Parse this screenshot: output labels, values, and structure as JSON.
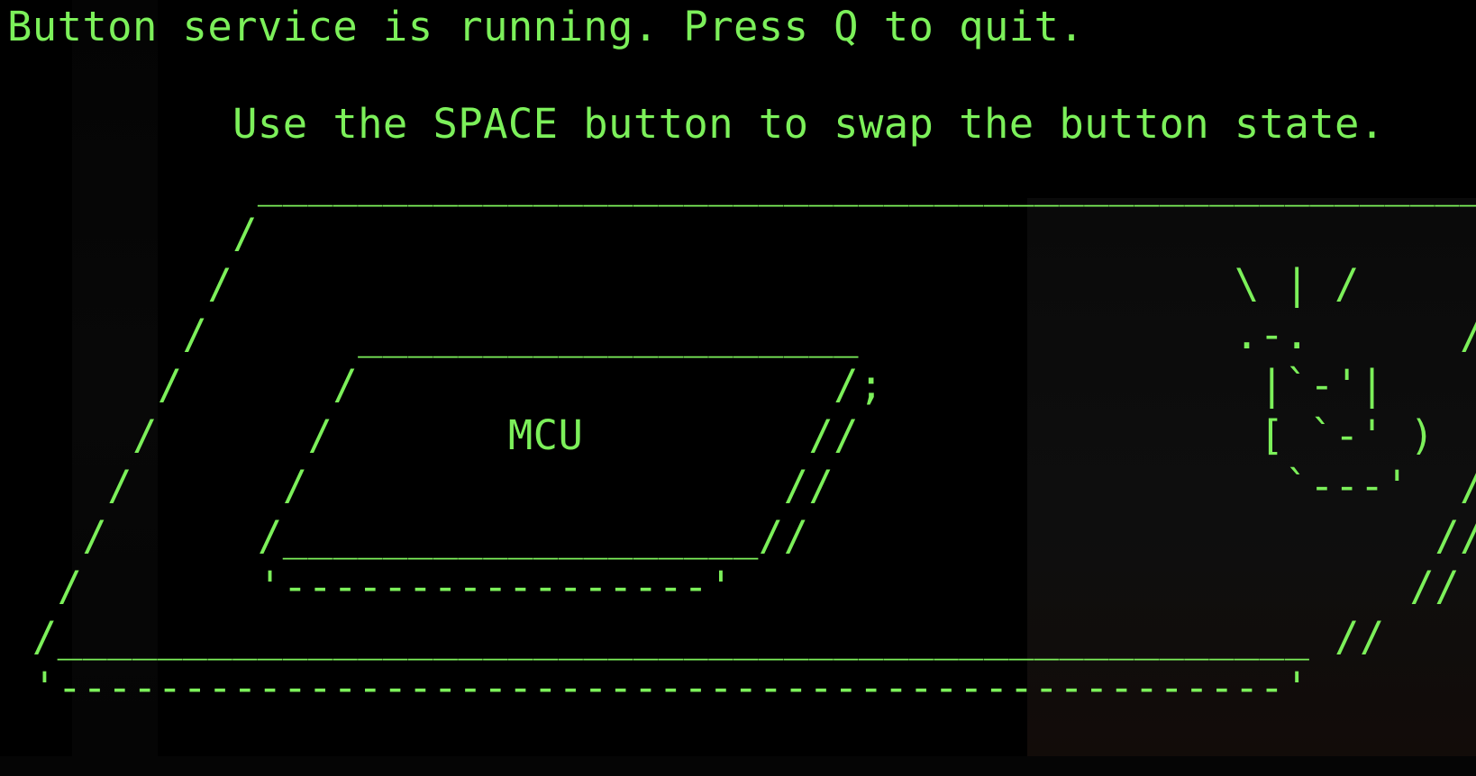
{
  "terminal": {
    "status_text": "Button service is running. Press Q to quit.",
    "instruction_text": "         Use the SPACE button to swap the button state.",
    "diagram_lines": [
      "          ___________________________________________________",
      "         /                                                  /;",
      "        /                                        \\ | /     //",
      "       /      ____________________               .-.      //",
      "      /      /                   /;               |`-'|    //",
      "     /      /       MCU         //                [ `-' )  //",
      "    /      /                   //                  `---'  //",
      "   /      /___________________//                         //",
      "  /       '-----------------'                           //",
      " /__________________________________________________ //",
      " '-------------------------------------------------'"
    ],
    "mcu_label": "MCU",
    "text_color": "#7CF05A",
    "background_color": "#000000"
  }
}
